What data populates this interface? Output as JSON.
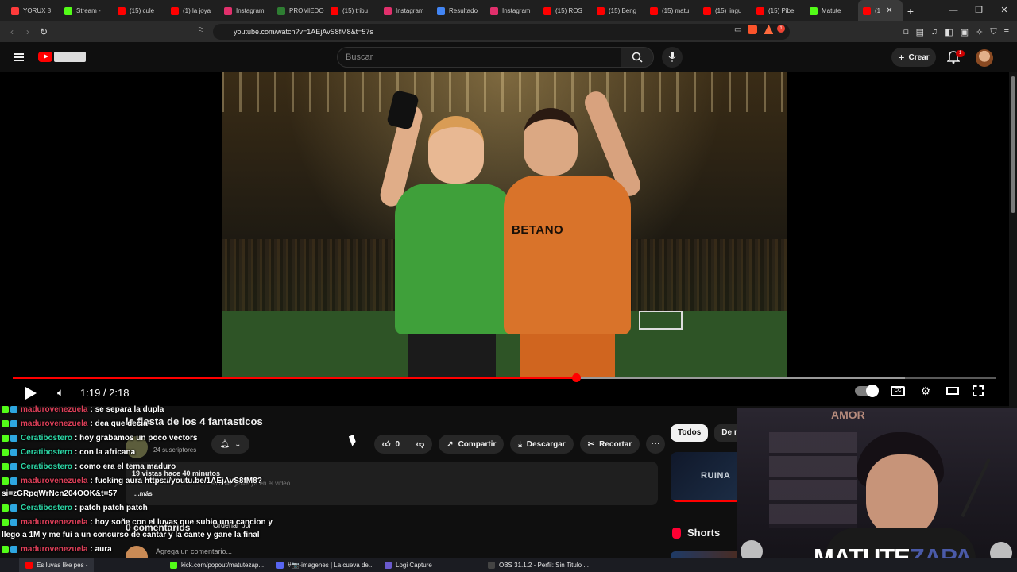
{
  "browser": {
    "tabs": [
      {
        "label": "YORUX 8",
        "color": "#ff3b3b"
      },
      {
        "label": "Stream -",
        "color": "#53fc18"
      },
      {
        "label": "(15) cule",
        "color": "#ff0000"
      },
      {
        "label": "(1) la joya",
        "color": "#ff0000"
      },
      {
        "label": "Instagram",
        "color": "#e1306c"
      },
      {
        "label": "PROMIEDO",
        "color": "#2e7d32"
      },
      {
        "label": "(15) tribu",
        "color": "#ff0000"
      },
      {
        "label": "Instagram",
        "color": "#e1306c"
      },
      {
        "label": "Resultado",
        "color": "#4285f4"
      },
      {
        "label": "Instagram",
        "color": "#e1306c"
      },
      {
        "label": "(15) ROS",
        "color": "#ff0000"
      },
      {
        "label": "(15) Beng",
        "color": "#ff0000"
      },
      {
        "label": "(15) matu",
        "color": "#ff0000"
      },
      {
        "label": "(15) lingu",
        "color": "#ff0000"
      },
      {
        "label": "(15) Pibe",
        "color": "#ff0000"
      },
      {
        "label": "Matute",
        "color": "#53fc18"
      }
    ],
    "active_tab": {
      "label": "(1",
      "close": "✕"
    },
    "new_tab": "+",
    "window_controls": {
      "minimize": "—",
      "maximize": "❐",
      "close": "✕"
    },
    "url": "youtube.com/watch?v=1AEjAvS8fM8&t=57s",
    "notification_count": "1"
  },
  "youtube": {
    "search_placeholder": "Buscar",
    "create_label": "Crear",
    "notification_count": "1"
  },
  "player": {
    "time_display": "1:19 / 2:18",
    "played_fraction": 0.573,
    "buffered_fraction": 0.907,
    "jersey_sponsor": "BETANO",
    "cc_label": "CC"
  },
  "video": {
    "title": "la fiesta de los 4 fantasticos",
    "subscribers": "24 suscriptores",
    "likes": "0",
    "share_label": "Compartir",
    "download_label": "Descargar",
    "clip_label": "Recortar",
    "more_actions": "···",
    "views_date": "19 vistas  hace 40 minutos",
    "description_fragment": "...ento de gente ya en el video.",
    "more_label": "...más",
    "comments_count": "0 comentarios",
    "sort_label": "Ordenar por",
    "add_comment_placeholder": "Agrega un comentario..."
  },
  "sidebar": {
    "chips": [
      "Todos",
      "De mz"
    ],
    "related_thumb_text": "RUINA",
    "shorts_label": "Shorts"
  },
  "stream_overlay": {
    "name_white": "MATUTE",
    "name_color": "ZAPA",
    "wall_text": "AMOR"
  },
  "chat": [
    {
      "user": "madurovenezuela",
      "color": "red",
      "text": ": se separa la dupla"
    },
    {
      "user": "madurovenezuela",
      "color": "red",
      "text": ": dea que decia"
    },
    {
      "user": "Ceratibostero",
      "color": "teal",
      "text": ": hoy grabamos un poco vectors"
    },
    {
      "user": "Ceratibostero",
      "color": "teal",
      "text": ": con la africana"
    },
    {
      "user": "Ceratibostero",
      "color": "teal",
      "text": ": como era el tema maduro"
    },
    {
      "user": "madurovenezuela",
      "color": "red",
      "text": ": fucking aura https://youtu.be/1AEjAvS8fM8?"
    },
    {
      "user": "",
      "color": "none",
      "text": "si=zGRpqWrNcn204OOK&t=57"
    },
    {
      "user": "Ceratibostero",
      "color": "teal",
      "text": ": patch patch patch"
    },
    {
      "user": "madurovenezuela",
      "color": "red",
      "text": ": hoy soñe con el luvas que subio una cancion y"
    },
    {
      "user": "",
      "color": "none",
      "text": "llego a 1M y me fui a un concurso de cantar y la cante y gane la final"
    },
    {
      "user": "madurovenezuela",
      "color": "red",
      "text": ": aura"
    }
  ],
  "taskbar": [
    {
      "label": "Es luvas like pes -",
      "color": "#ff0000"
    },
    {
      "label": "kick.com/popout/matutezap...",
      "color": "#53fc18"
    },
    {
      "label": "#📷-imagenes | La cueva de...",
      "color": "#5865f2"
    },
    {
      "label": "Logi Capture",
      "color": "#6a5acd"
    },
    {
      "label": "OBS 31.1.2 - Perfil: Sin Titulo ...",
      "color": "#444444"
    }
  ]
}
